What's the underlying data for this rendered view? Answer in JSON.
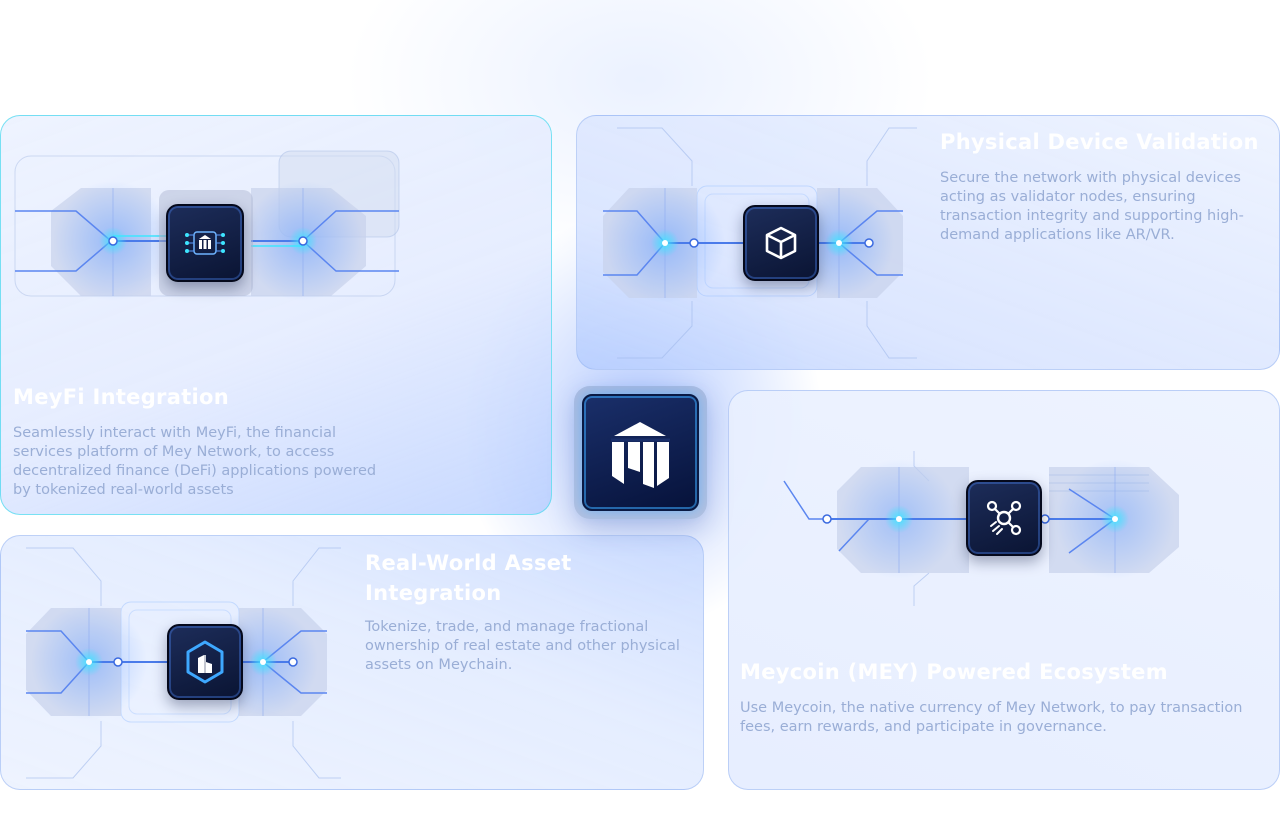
{
  "cards": {
    "meyfi": {
      "title": "MeyFi Integration",
      "description": "Seamlessly interact with MeyFi, the financial services platform of Mey Network, to access decentralized finance (DeFi) applications powered by tokenized real-world assets",
      "icon": "bank-building-icon"
    },
    "device": {
      "title": "Physical Device Validation",
      "description": "Secure the network with physical devices acting as validator nodes, ensuring transaction integrity and supporting high-demand applications like AR/VR.",
      "icon": "cube-icon"
    },
    "rwa": {
      "title_line1": "Real-World Asset",
      "title_line2": "Integration",
      "description": "Tokenize, trade, and manage fractional ownership of real estate and other physical assets on Meychain.",
      "icon": "building-hexagon-icon"
    },
    "meycoin": {
      "title": "Meycoin (MEY) Powered Ecosystem",
      "description": "Use Meycoin, the native currency of Mey Network, to pay transaction fees, earn rewards, and participate in governance.",
      "icon": "network-nodes-icon"
    }
  },
  "center": {
    "icon": "mey-network-logo-icon"
  },
  "colors": {
    "accent_cyan": "#3ee6ff",
    "chip_dark": "#0a1433",
    "line_blue": "#4a7bea",
    "description_text": "#9aaed6"
  }
}
